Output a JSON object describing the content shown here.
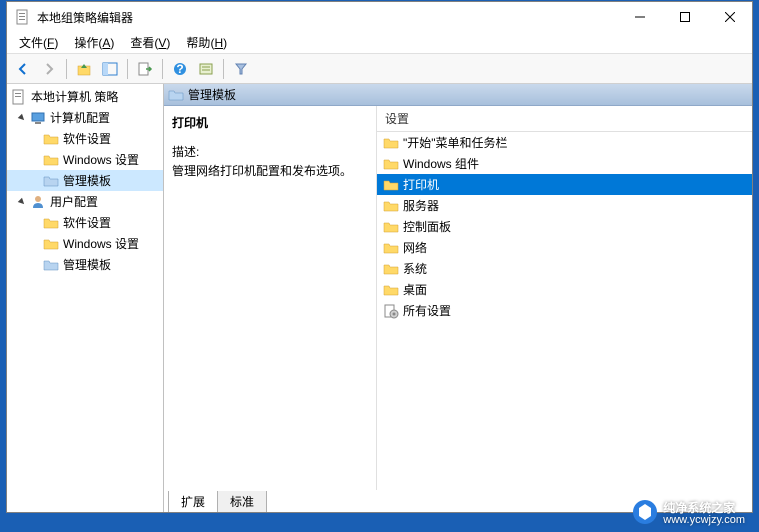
{
  "window": {
    "title": "本地组策略编辑器"
  },
  "menubar": [
    {
      "label": "文件",
      "key": "F"
    },
    {
      "label": "操作",
      "key": "A"
    },
    {
      "label": "查看",
      "key": "V"
    },
    {
      "label": "帮助",
      "key": "H"
    }
  ],
  "tree": {
    "root": "本地计算机 策略",
    "computer": "计算机配置",
    "user": "用户配置",
    "software": "软件设置",
    "windows": "Windows 设置",
    "templates": "管理模板"
  },
  "breadcrumb": {
    "label": "管理模板"
  },
  "detail": {
    "title": "打印机",
    "desc_label": "描述:",
    "desc_text": "管理网络打印机配置和发布选项。"
  },
  "list": {
    "header": "设置",
    "items": [
      {
        "label": "\"开始\"菜单和任务栏",
        "type": "folder"
      },
      {
        "label": "Windows 组件",
        "type": "folder"
      },
      {
        "label": "打印机",
        "type": "folder",
        "selected": true
      },
      {
        "label": "服务器",
        "type": "folder"
      },
      {
        "label": "控制面板",
        "type": "folder"
      },
      {
        "label": "网络",
        "type": "folder"
      },
      {
        "label": "系统",
        "type": "folder"
      },
      {
        "label": "桌面",
        "type": "folder"
      },
      {
        "label": "所有设置",
        "type": "settings"
      }
    ]
  },
  "tabs": {
    "extended": "扩展",
    "standard": "标准"
  },
  "watermark": {
    "brand": "纯净系统之家",
    "url": "www.ycwjzy.com"
  }
}
